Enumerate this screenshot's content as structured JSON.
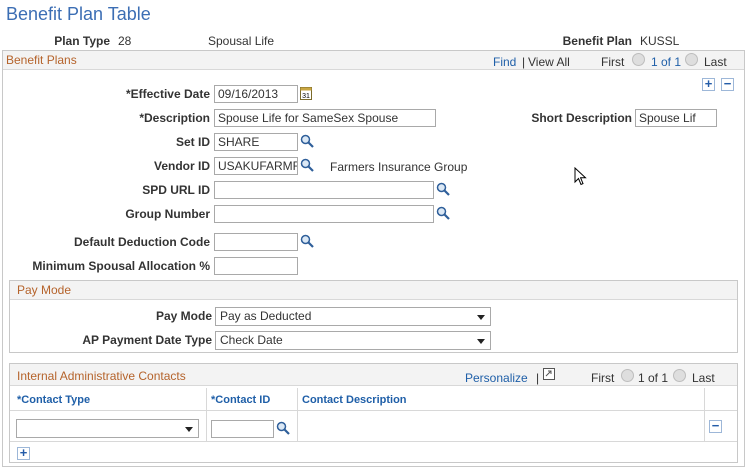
{
  "page": {
    "title": "Benefit Plan Table"
  },
  "header": {
    "plan_type_label": "Plan Type",
    "plan_type_value": "28",
    "plan_type_desc": "Spousal Life",
    "benefit_plan_label": "Benefit Plan",
    "benefit_plan_value": "KUSSL"
  },
  "benefit_plans": {
    "section_title": "Benefit Plans",
    "nav": {
      "find": "Find",
      "sep": "|",
      "view_all": "View All",
      "first": "First",
      "range": "1 of 1",
      "last": "Last"
    },
    "fields": {
      "effective_date_label": "*Effective Date",
      "effective_date_value": "09/16/2013",
      "description_label": "*Description",
      "description_value": "Spouse Life for SameSex Spouse",
      "short_desc_label": "Short Description",
      "short_desc_value": "Spouse Lif",
      "setid_label": "Set ID",
      "setid_value": "SHARE",
      "vendor_label": "Vendor ID",
      "vendor_value": "USAKUFARMR",
      "vendor_desc": "Farmers Insurance Group",
      "spd_url_label": "SPD URL ID",
      "spd_url_value": "",
      "group_number_label": "Group Number",
      "group_number_value": "",
      "default_deduction_label": "Default Deduction Code",
      "default_deduction_value": "",
      "min_spousal_label": "Minimum Spousal Allocation %",
      "min_spousal_value": ""
    }
  },
  "pay_mode": {
    "section_title": "Pay Mode",
    "pay_mode_label": "Pay Mode",
    "pay_mode_value": "Pay as Deducted",
    "ap_payment_label": "AP Payment Date Type",
    "ap_payment_value": "Check Date"
  },
  "contacts": {
    "section_title": "Internal Administrative Contacts",
    "nav": {
      "personalize": "Personalize",
      "sep": "|",
      "first": "First",
      "range": "1 of 1",
      "last": "Last"
    },
    "columns": [
      "*Contact Type",
      "*Contact ID",
      "Contact Description"
    ],
    "row": {
      "contact_type": "",
      "contact_id": "",
      "contact_desc": ""
    }
  },
  "icons": {
    "calendar": "calendar-icon",
    "lookup": "magnifier-icon",
    "add": "plus-icon",
    "delete": "minus-icon",
    "grid": "grid-icon",
    "cursor": "mouse-pointer-icon"
  }
}
